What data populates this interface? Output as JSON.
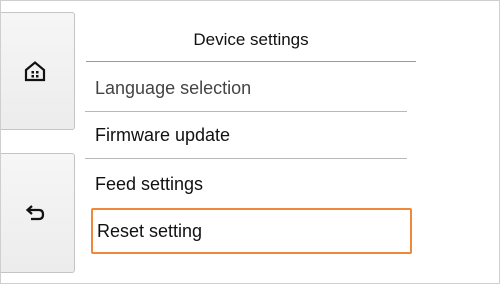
{
  "header": {
    "title": "Device settings"
  },
  "nav": {
    "home_icon": "home-icon",
    "back_icon": "back-icon"
  },
  "menu": {
    "items": [
      {
        "label": "Language selection"
      },
      {
        "label": "Firmware update"
      },
      {
        "label": "Feed settings"
      },
      {
        "label": "Reset setting",
        "selected": true
      }
    ]
  },
  "colors": {
    "selection_border": "#f0883a",
    "side_button_bg": "#efefef"
  }
}
